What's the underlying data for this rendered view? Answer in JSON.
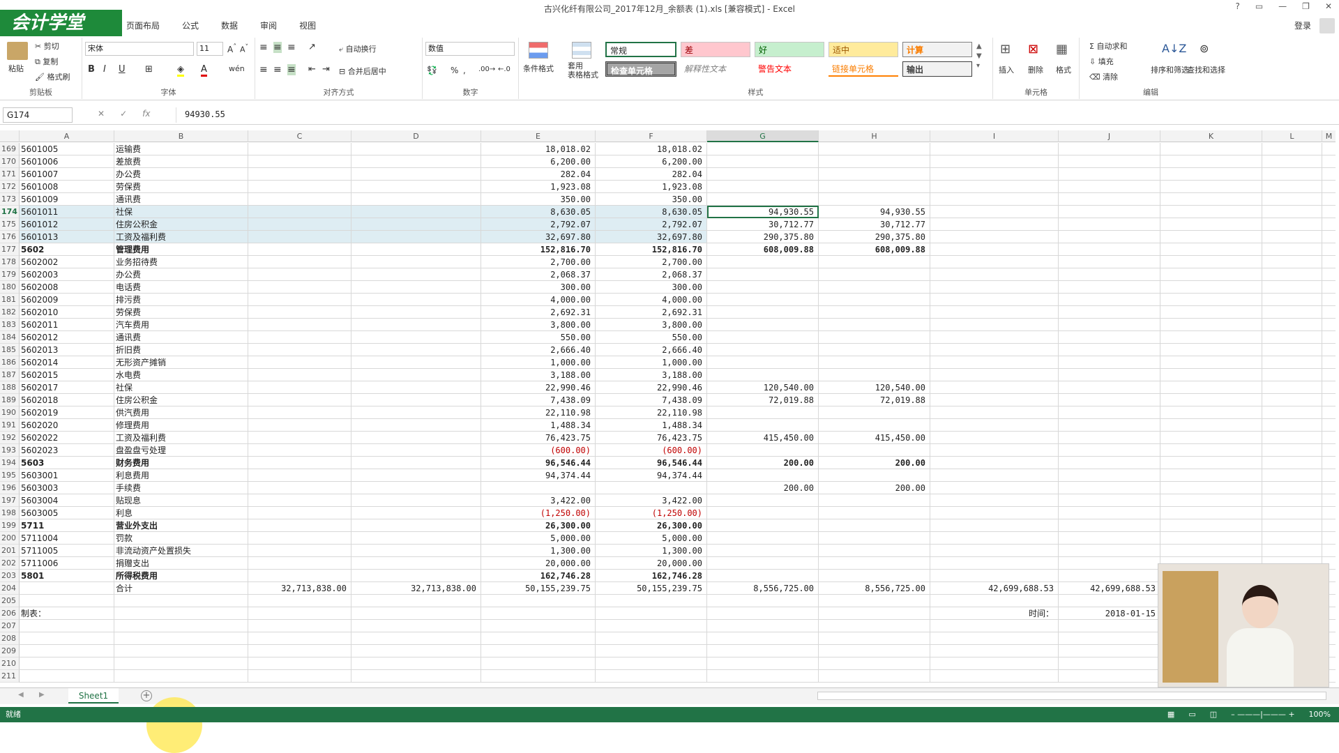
{
  "app": {
    "title": "古兴化纤有限公司_2017年12月_余额表 (1).xls  [兼容模式] - Excel",
    "logo_text": "会计学堂",
    "login": "登录"
  },
  "tabs": [
    "页面布局",
    "公式",
    "数据",
    "审阅",
    "视图"
  ],
  "ribbon": {
    "clipboard": {
      "label": "剪贴板",
      "paste": "粘贴",
      "cut": "剪切",
      "copy": "复制",
      "format_painter": "格式刷"
    },
    "font": {
      "label": "字体",
      "font_name": "宋体",
      "font_size": "11"
    },
    "alignment": {
      "label": "对齐方式",
      "wrap": "自动换行",
      "merge": "合并后居中"
    },
    "number": {
      "label": "数字",
      "format": "数值"
    },
    "styles": {
      "label": "样式",
      "conditional": "条件格式",
      "table": "套用\n表格格式",
      "normal": "常规",
      "bad": "差",
      "good": "好",
      "neutral": "适中",
      "calc": "计算",
      "check": "检查单元格",
      "explanatory": "解释性文本",
      "warning": "警告文本",
      "linked": "链接单元格",
      "output": "输出"
    },
    "cells": {
      "label": "单元格",
      "insert": "插入",
      "delete": "删除",
      "format": "格式"
    },
    "editing": {
      "label": "编辑",
      "autosum": "自动求和",
      "fill": "填充",
      "clear": "清除",
      "sort": "排序和筛选",
      "find": "查找和选择"
    }
  },
  "formula_bar": {
    "name_box": "G174",
    "fx": "fx",
    "value": "94930.55"
  },
  "columns": [
    "A",
    "B",
    "C",
    "D",
    "E",
    "F",
    "G",
    "H",
    "I",
    "J",
    "K",
    "L",
    "M"
  ],
  "rows": [
    {
      "n": "169",
      "a": "5601005",
      "b": "运输费",
      "e": "18,018.02",
      "f": "18,018.02"
    },
    {
      "n": "170",
      "a": "5601006",
      "b": "差旅费",
      "e": "6,200.00",
      "f": "6,200.00"
    },
    {
      "n": "171",
      "a": "5601007",
      "b": "办公费",
      "e": "282.04",
      "f": "282.04"
    },
    {
      "n": "172",
      "a": "5601008",
      "b": "劳保费",
      "e": "1,923.08",
      "f": "1,923.08"
    },
    {
      "n": "173",
      "a": "5601009",
      "b": "通讯费",
      "e": "350.00",
      "f": "350.00"
    },
    {
      "n": "174",
      "a": "5601011",
      "b": "社保",
      "e": "8,630.05",
      "f": "8,630.05",
      "g": "94,930.55",
      "h": "94,930.55"
    },
    {
      "n": "175",
      "a": "5601012",
      "b": "住房公积金",
      "e": "2,792.07",
      "f": "2,792.07",
      "g": "30,712.77",
      "h": "30,712.77"
    },
    {
      "n": "176",
      "a": "5601013",
      "b": "工资及福利费",
      "e": "32,697.80",
      "f": "32,697.80",
      "g": "290,375.80",
      "h": "290,375.80"
    },
    {
      "n": "177",
      "a": "5602",
      "b": "管理费用",
      "e": "152,816.70",
      "f": "152,816.70",
      "g": "608,009.88",
      "h": "608,009.88"
    },
    {
      "n": "178",
      "a": "5602002",
      "b": "业务招待费",
      "e": "2,700.00",
      "f": "2,700.00"
    },
    {
      "n": "179",
      "a": "5602003",
      "b": "办公费",
      "e": "2,068.37",
      "f": "2,068.37"
    },
    {
      "n": "180",
      "a": "5602008",
      "b": "电话费",
      "e": "300.00",
      "f": "300.00"
    },
    {
      "n": "181",
      "a": "5602009",
      "b": "排污费",
      "e": "4,000.00",
      "f": "4,000.00"
    },
    {
      "n": "182",
      "a": "5602010",
      "b": "劳保费",
      "e": "2,692.31",
      "f": "2,692.31"
    },
    {
      "n": "183",
      "a": "5602011",
      "b": "汽车费用",
      "e": "3,800.00",
      "f": "3,800.00"
    },
    {
      "n": "184",
      "a": "5602012",
      "b": "通讯费",
      "e": "550.00",
      "f": "550.00"
    },
    {
      "n": "185",
      "a": "5602013",
      "b": "折旧费",
      "e": "2,666.40",
      "f": "2,666.40"
    },
    {
      "n": "186",
      "a": "5602014",
      "b": "无形资产摊销",
      "e": "1,000.00",
      "f": "1,000.00"
    },
    {
      "n": "187",
      "a": "5602015",
      "b": "水电费",
      "e": "3,188.00",
      "f": "3,188.00"
    },
    {
      "n": "188",
      "a": "5602017",
      "b": "社保",
      "e": "22,990.46",
      "f": "22,990.46",
      "g": "120,540.00",
      "h": "120,540.00"
    },
    {
      "n": "189",
      "a": "5602018",
      "b": "住房公积金",
      "e": "7,438.09",
      "f": "7,438.09",
      "g": "72,019.88",
      "h": "72,019.88"
    },
    {
      "n": "190",
      "a": "5602019",
      "b": "供汽费用",
      "e": "22,110.98",
      "f": "22,110.98"
    },
    {
      "n": "191",
      "a": "5602020",
      "b": "修理费用",
      "e": "1,488.34",
      "f": "1,488.34"
    },
    {
      "n": "192",
      "a": "5602022",
      "b": "工资及福利费",
      "e": "76,423.75",
      "f": "76,423.75",
      "g": "415,450.00",
      "h": "415,450.00"
    },
    {
      "n": "193",
      "a": "5602023",
      "b": "盘盈盘亏处理",
      "e": "(600.00)",
      "f": "(600.00)"
    },
    {
      "n": "194",
      "a": "5603",
      "b": "财务费用",
      "e": "96,546.44",
      "f": "96,546.44",
      "g": "200.00",
      "h": "200.00"
    },
    {
      "n": "195",
      "a": "5603001",
      "b": "利息费用",
      "e": "94,374.44",
      "f": "94,374.44"
    },
    {
      "n": "196",
      "a": "5603003",
      "b": "手续费",
      "g": "200.00",
      "h": "200.00"
    },
    {
      "n": "197",
      "a": "5603004",
      "b": "贴现息",
      "e": "3,422.00",
      "f": "3,422.00"
    },
    {
      "n": "198",
      "a": "5603005",
      "b": "利息",
      "e": "(1,250.00)",
      "f": "(1,250.00)"
    },
    {
      "n": "199",
      "a": "5711",
      "b": "营业外支出",
      "e": "26,300.00",
      "f": "26,300.00"
    },
    {
      "n": "200",
      "a": "5711004",
      "b": "罚款",
      "e": "5,000.00",
      "f": "5,000.00"
    },
    {
      "n": "201",
      "a": "5711005",
      "b": "非流动资产处置损失",
      "e": "1,300.00",
      "f": "1,300.00"
    },
    {
      "n": "202",
      "a": "5711006",
      "b": "捐赠支出",
      "e": "20,000.00",
      "f": "20,000.00"
    },
    {
      "n": "203",
      "a": "5801",
      "b": "所得税费用",
      "e": "162,746.28",
      "f": "162,746.28"
    },
    {
      "n": "204",
      "a": "",
      "b": "合计",
      "c": "32,713,838.00",
      "d": "32,713,838.00",
      "e": "50,155,239.75",
      "f": "50,155,239.75",
      "g": "8,556,725.00",
      "h": "8,556,725.00",
      "i": "42,699,688.53",
      "j": "42,699,688.53"
    },
    {
      "n": "205",
      "a": "",
      "b": ""
    },
    {
      "n": "206",
      "a": "制表：",
      "b": "",
      "i": "时间：",
      "j": "2018-01-15"
    },
    {
      "n": "207",
      "a": "",
      "b": ""
    },
    {
      "n": "208",
      "a": "",
      "b": ""
    },
    {
      "n": "209",
      "a": "",
      "b": ""
    },
    {
      "n": "210",
      "a": "",
      "b": ""
    },
    {
      "n": "211",
      "a": "",
      "b": ""
    }
  ],
  "sheet_tab": "Sheet1",
  "status": {
    "ready": "就绪",
    "zoom": "100%"
  }
}
